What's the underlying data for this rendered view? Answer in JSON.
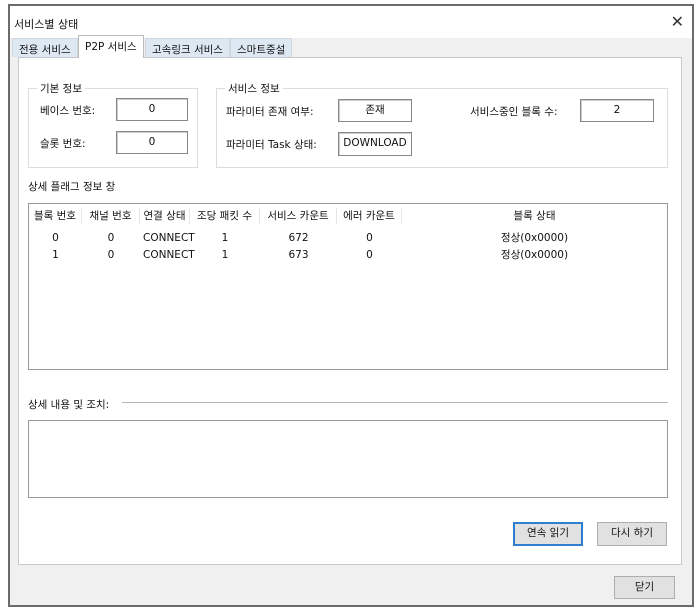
{
  "window": {
    "title": "서비스별 상태",
    "close_symbol": "✕"
  },
  "tabs": [
    {
      "label": "전용 서비스"
    },
    {
      "label": "P2P 서비스"
    },
    {
      "label": "고속링크 서비스"
    },
    {
      "label": "스마트중설"
    }
  ],
  "basic_info": {
    "title": "기본 정보",
    "base_label": "베이스 번호:",
    "base_value": "0",
    "slot_label": "슬롯 번호:",
    "slot_value": "0"
  },
  "service_info": {
    "title": "서비스 정보",
    "param_exist_label": "파라미터 존재 여부:",
    "param_exist_value": "존재",
    "task_label": "파라미터 Task 상태:",
    "task_value": "DOWNLOAD",
    "blocks_label": "서비스중인 블록 수:",
    "blocks_value": "2"
  },
  "flag_section": {
    "title": "상세 플래그 정보 창"
  },
  "table": {
    "headers": [
      "블록 번호",
      "채널 번호",
      "연결 상태",
      "조당 패킷 수",
      "서비스 카운트",
      "에러 카운트",
      "블록 상태"
    ],
    "rows": [
      [
        "0",
        "0",
        "CONNECT",
        "1",
        "672",
        "0",
        "정상(0x0000)"
      ],
      [
        "1",
        "0",
        "CONNECT",
        "1",
        "673",
        "0",
        "정상(0x0000)"
      ]
    ]
  },
  "detail": {
    "label": "상세 내용 및 조치:",
    "value": ""
  },
  "buttons": {
    "continuous_read": "연속 읽기",
    "retry": "다시 하기",
    "close": "닫기"
  }
}
